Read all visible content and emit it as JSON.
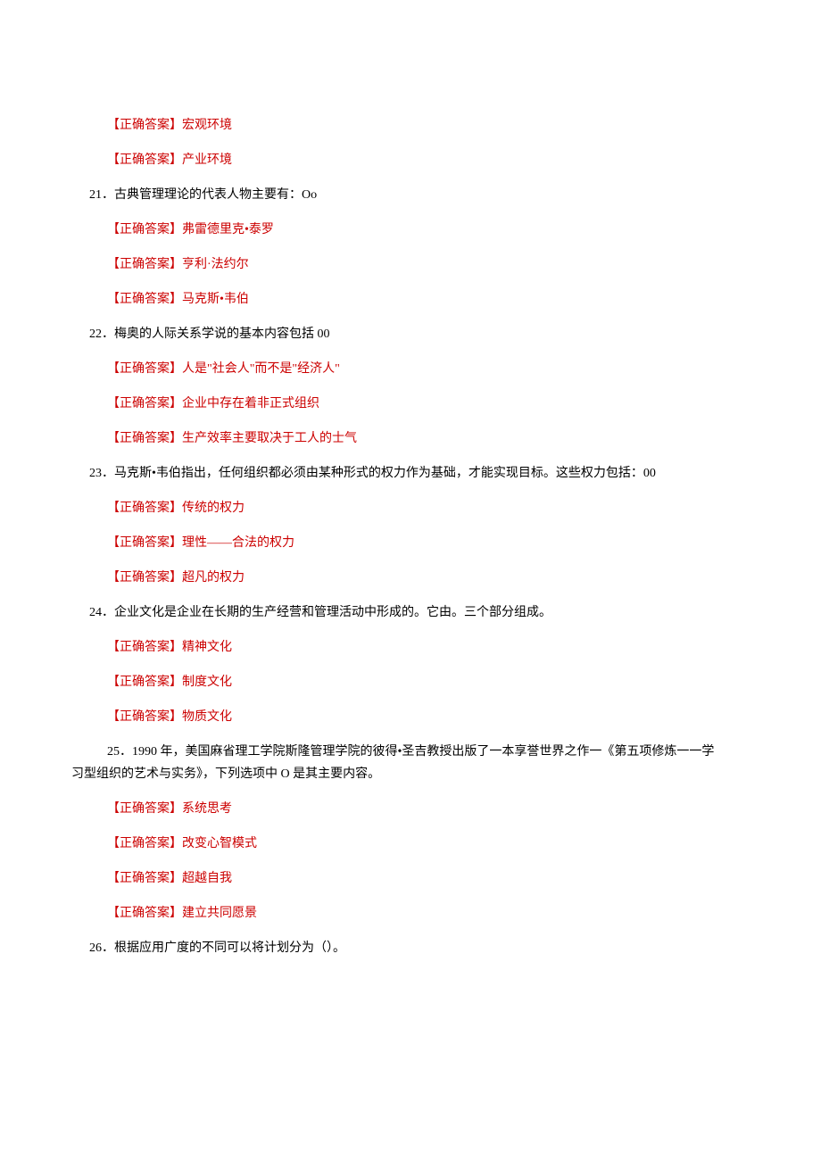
{
  "answer_label": "【正确答案】",
  "items": [
    {
      "type": "answer",
      "text": "宏观环境"
    },
    {
      "type": "answer",
      "text": "产业环境"
    },
    {
      "type": "question",
      "num": "21",
      "text": "．古典管理理论的代表人物主要有：Oo"
    },
    {
      "type": "answer",
      "text": "弗雷德里克•泰罗"
    },
    {
      "type": "answer",
      "text": "亨利·法约尔"
    },
    {
      "type": "answer",
      "text": "马克斯•韦伯"
    },
    {
      "type": "question",
      "num": "22",
      "text": "．梅奥的人际关系学说的基本内容包括 00"
    },
    {
      "type": "answer",
      "text": "人是\"社会人\"而不是\"经济人\""
    },
    {
      "type": "answer",
      "text": "企业中存在着非正式组织"
    },
    {
      "type": "answer",
      "text": "生产效率主要取决于工人的士气"
    },
    {
      "type": "question",
      "num": "23",
      "text": "．马克斯•韦伯指出，任何组织都必须由某种形式的权力作为基础，才能实现目标。这些权力包括：00"
    },
    {
      "type": "answer",
      "text": "传统的权力"
    },
    {
      "type": "answer",
      "text": "理性——合法的权力"
    },
    {
      "type": "answer",
      "text": "超凡的权力"
    },
    {
      "type": "question",
      "num": "24",
      "text": "．企业文化是企业在长期的生产经营和管理活动中形成的。它由。三个部分组成。"
    },
    {
      "type": "answer",
      "text": "精神文化"
    },
    {
      "type": "answer",
      "text": "制度文化"
    },
    {
      "type": "answer",
      "text": "物质文化"
    },
    {
      "type": "question25",
      "num": "25",
      "text1": "．1990 年，美国麻省理工学院斯隆管理学院的彼得•圣吉教授出版了一本享誉世界之作一《第五项修炼一一学",
      "text2": "习型组织的艺术与实务》，下列选项中 O 是其主要内容。"
    },
    {
      "type": "answer",
      "text": "系统思考"
    },
    {
      "type": "answer",
      "text": "改变心智模式"
    },
    {
      "type": "answer",
      "text": "超越自我"
    },
    {
      "type": "answer",
      "text": "建立共同愿景"
    },
    {
      "type": "question",
      "num": "26",
      "text": "．根据应用广度的不同可以将计划分为（）。"
    }
  ]
}
